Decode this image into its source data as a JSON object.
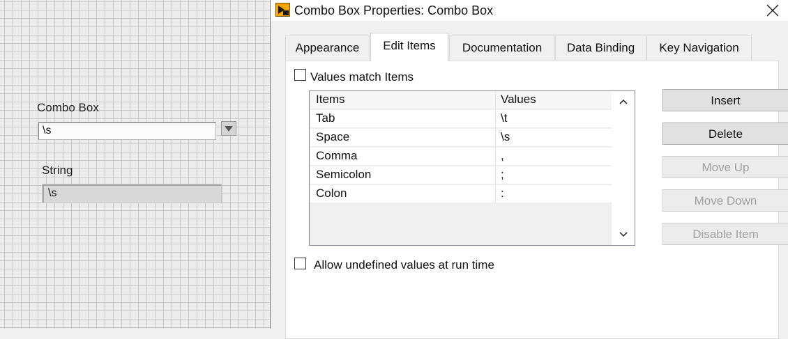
{
  "front_panel": {
    "combo_label": "Combo Box",
    "combo_value": "\\s",
    "string_label": "String",
    "string_value": "\\s"
  },
  "dialog": {
    "title": "Combo Box Properties: Combo Box",
    "tabs": [
      {
        "label": "Appearance",
        "active": false
      },
      {
        "label": "Edit Items",
        "active": true
      },
      {
        "label": "Documentation",
        "active": false
      },
      {
        "label": "Data Binding",
        "active": false
      },
      {
        "label": "Key Navigation",
        "active": false
      }
    ],
    "values_match_items": {
      "label": "Values match Items",
      "checked": false
    },
    "table": {
      "headers": {
        "items": "Items",
        "values": "Values"
      },
      "rows": [
        {
          "item": "Tab",
          "value": "\\t"
        },
        {
          "item": "Space",
          "value": "\\s"
        },
        {
          "item": "Comma",
          "value": ","
        },
        {
          "item": "Semicolon",
          "value": ";"
        },
        {
          "item": "Colon",
          "value": ":"
        }
      ]
    },
    "buttons": {
      "insert": "Insert",
      "delete": "Delete",
      "move_up": "Move Up",
      "move_down": "Move Down",
      "disable_item": "Disable Item"
    },
    "allow_undefined": {
      "label": "Allow undefined values at run time",
      "checked": false
    }
  },
  "icons": {
    "app": "labview-vi-icon",
    "close": "close-icon",
    "combo_dropdown": "dropdown-arrow-icon",
    "scroll_up": "chevron-up-icon",
    "scroll_down": "chevron-down-icon"
  },
  "colors": {
    "panel_grid": "#c9c9c9",
    "panel_bg": "#ececec",
    "dialog_bg": "#f0f0f0",
    "app_icon": "#f2a400"
  }
}
